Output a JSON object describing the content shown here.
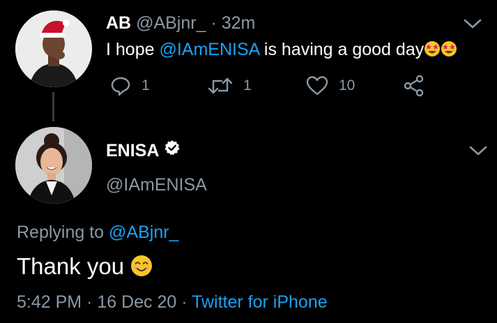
{
  "tweet": {
    "author_name": "AB",
    "handle": "@ABjnr_",
    "separator": "·",
    "time_ago": "32m",
    "text_before": "I hope ",
    "mention": "@IAmENISA",
    "text_after": " is having a good day",
    "emoji": "🤩🤩",
    "reply_count": "1",
    "retweet_count": "1",
    "like_count": "10"
  },
  "reply": {
    "author_name": "ENISA",
    "handle": "@IAmENISA",
    "replying_prefix": "Replying to ",
    "replying_handle": "@ABjnr_",
    "text": "Thank you ",
    "emoji": "😊",
    "time": "5:42 PM",
    "separator": "·",
    "date": "16 Dec 20",
    "source": "Twitter for iPhone"
  },
  "icons": {
    "reply": "reply-icon",
    "retweet": "retweet-icon",
    "like": "heart-icon",
    "share": "share-icon",
    "verified": "verified-badge-icon",
    "more": "chevron-down-icon"
  },
  "colors": {
    "background": "#000000",
    "text": "#ffffff",
    "muted": "#8b98a5",
    "link": "#1da1f2",
    "thread_line": "#3a3a3a"
  }
}
